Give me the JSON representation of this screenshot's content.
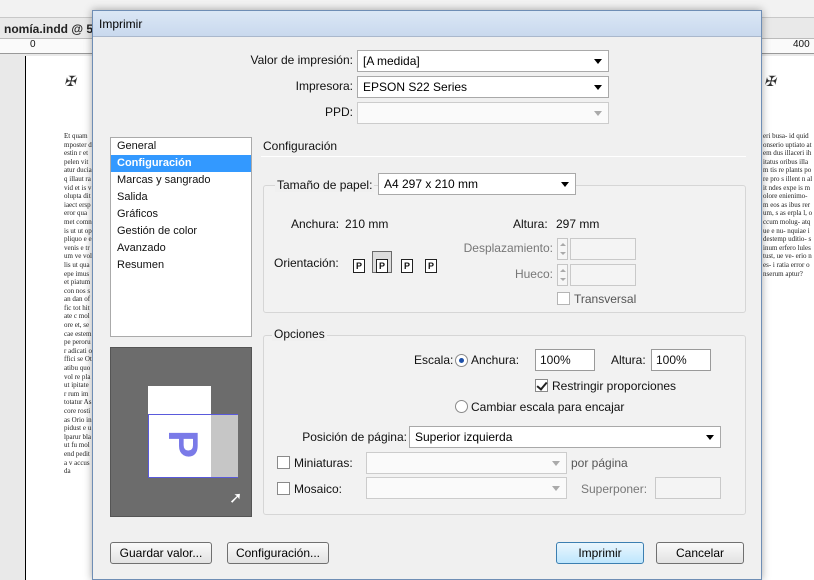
{
  "background": {
    "doc_tab": "nomía.indd @ 5",
    "ruler_left": "0",
    "ruler_right": "400",
    "text_left": "Et quam mposter destin r et pelen vit atur ducia q illaut ra vid et is volupta ditiaect ersperor quamet comnis ut ut op pliquo e evenis e trum ve vollis ut quaepe imus et piatum con nos san dan offic tot hitate c molore et, secae estempe perorur adicati offici se Otatibu quo vol re plaut ipitate r rum im totatur As core rostias Orio in pidust e ulparur blaut fu molend pedita v accusda",
    "text_right": "eri busa- id quid onserio uptiato atem dus illaceri ihitatus oribus illam tis re plants pore pro s illent n alit ndes expe is molore enienimo- m eos as ibus rerum, s as erpla l, occum molug- atque e nu- nquiae idestemp uditio- sinum erfero lules tust, ue ve- erio nes- i ratia error onserum aptur?"
  },
  "dialog": {
    "title": "Imprimir",
    "preset": {
      "label": "Valor de impresión:",
      "value": "[A medida]"
    },
    "printer": {
      "label": "Impresora:",
      "value": "EPSON S22 Series"
    },
    "ppd": {
      "label": "PPD:",
      "value": ""
    },
    "nav": {
      "items": [
        {
          "label": "General",
          "selected": false
        },
        {
          "label": "Configuración",
          "selected": true
        },
        {
          "label": "Marcas y sangrado",
          "selected": false
        },
        {
          "label": "Salida",
          "selected": false
        },
        {
          "label": "Gráficos",
          "selected": false
        },
        {
          "label": "Gestión de color",
          "selected": false
        },
        {
          "label": "Avanzado",
          "selected": false
        },
        {
          "label": "Resumen",
          "selected": false
        }
      ]
    },
    "preview": {
      "glyph": "P"
    },
    "setup": {
      "section_title": "Configuración",
      "paper_size_label": "Tamaño de papel:",
      "paper_size_value": "A4 297 x 210 mm",
      "width_label": "Anchura:",
      "width_value": "210 mm",
      "height_label": "Altura:",
      "height_value": "297 mm",
      "orientation_label": "Orientación:",
      "offset_label": "Desplazamiento:",
      "gap_label": "Hueco:",
      "transverse_label": "Transversal"
    },
    "options": {
      "section_title": "Opciones",
      "scale_label": "Escala:",
      "width_radio_label": "Anchura:",
      "width_value": "100%",
      "height_label": "Altura:",
      "height_value": "100%",
      "constrain_label": "Restringir proporciones",
      "fit_label": "Cambiar escala para encajar",
      "page_position_label": "Posición de página:",
      "page_position_value": "Superior izquierda",
      "thumbnails_label": "Miniaturas:",
      "per_page_label": "por página",
      "tile_label": "Mosaico:",
      "overlap_label": "Superponer:"
    },
    "buttons": {
      "save_preset": "Guardar valor...",
      "setup": "Configuración...",
      "print": "Imprimir",
      "cancel": "Cancelar"
    }
  }
}
